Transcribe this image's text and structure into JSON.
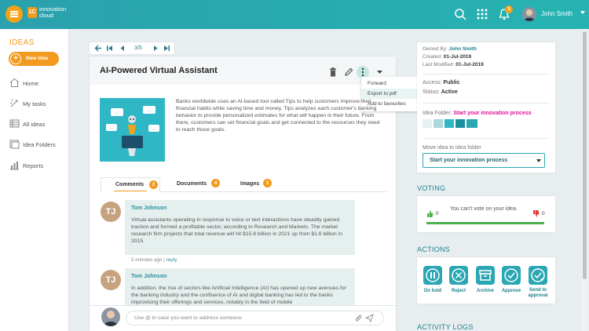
{
  "app": {
    "logo_mark": "1C",
    "logo_line1": "innovation",
    "logo_line2": "cloud"
  },
  "header": {
    "user_name": "John Smith",
    "notification_count": "1"
  },
  "sidebar": {
    "title": "IDEAS",
    "new_idea_label": "New Idea",
    "items": [
      {
        "label": "Home",
        "icon": "home-icon"
      },
      {
        "label": "My tasks",
        "icon": "tasks-icon"
      },
      {
        "label": "All ideas",
        "icon": "list-icon"
      },
      {
        "label": "Idea Folders",
        "icon": "folder-icon"
      },
      {
        "label": "Reports",
        "icon": "reports-icon"
      }
    ]
  },
  "pager": {
    "position": "3/5"
  },
  "idea": {
    "title": "AI-Powered Virtual Assistant",
    "description": "Banks worldwide uses an AI-based tool called Tips to help customers improve their financial habits while saving time and money. Tips analyzes each customer's banking behavior to provide personalized estimates for what will happen in their future. From there, customers can set financial goals and get connected to the resources they need to reach those goals."
  },
  "more_menu": {
    "items": [
      "Forward",
      "Export to pdf",
      "Add to favourites"
    ]
  },
  "tabs": [
    {
      "label": "Comments",
      "count": "2"
    },
    {
      "label": "Documents",
      "count": "4"
    },
    {
      "label": "Images",
      "count": "1"
    }
  ],
  "comments": [
    {
      "initials": "TJ",
      "author": "Tom Johnson",
      "text": "Virtual assistants operating in response to voice or text interactions have steadily gained traction and formed a profitable sector, according to Research and Markets. The market research firm projects that total revenue will hit $15.8 billion in 2021 up from $1.6 billion in 2015.",
      "time": "5 minutes ago",
      "reply_label": "reply"
    },
    {
      "initials": "TJ",
      "author": "Tom Johnson",
      "text": "In addition, the rise of sectors like Artificial Intelligence (AI) has opened up new avenues for the banking industry and the confluence of AI and digital banking has led to the banks improvising their offerings and services, notably in the field of mobile"
    }
  ],
  "comment_input": {
    "placeholder": "Use @ in case you want to address someone"
  },
  "details": {
    "owned_by_label": "Owned By:",
    "owned_by": "John Smith",
    "created_label": "Created:",
    "created": "01-Jul-2019",
    "modified_label": "Last Modified:",
    "modified": "01-Jul-2019",
    "access_label": "Access:",
    "access": "Public",
    "status_label": "Status:",
    "status": "Active",
    "folder_label": "Idea Folder:",
    "folder": "Start your innovation process",
    "move_label": "Move idea to idea folder",
    "move_selected": "Start your innovation process"
  },
  "voting": {
    "title": "VOTING",
    "message": "You can't vote on your idea.",
    "up_count": "0",
    "down_count": "0",
    "up_color": "#4caf50",
    "down_color": "#e53935"
  },
  "actions": {
    "title": "ACTIONS",
    "buttons": [
      {
        "label": "On hold",
        "icon": "pause-icon"
      },
      {
        "label": "Reject",
        "icon": "reject-icon"
      },
      {
        "label": "Archive",
        "icon": "archive-icon"
      },
      {
        "label": "Approve",
        "icon": "check-icon"
      },
      {
        "label_line1": "Send to",
        "label_line2": "approval",
        "icon": "send-approval-icon"
      }
    ]
  },
  "activity": {
    "title": "ACTIVITY LOGS"
  },
  "colors": {
    "brand_teal": "#2aa7b3",
    "accent_orange": "#f29a1d",
    "folder_link": "#e0129a"
  }
}
